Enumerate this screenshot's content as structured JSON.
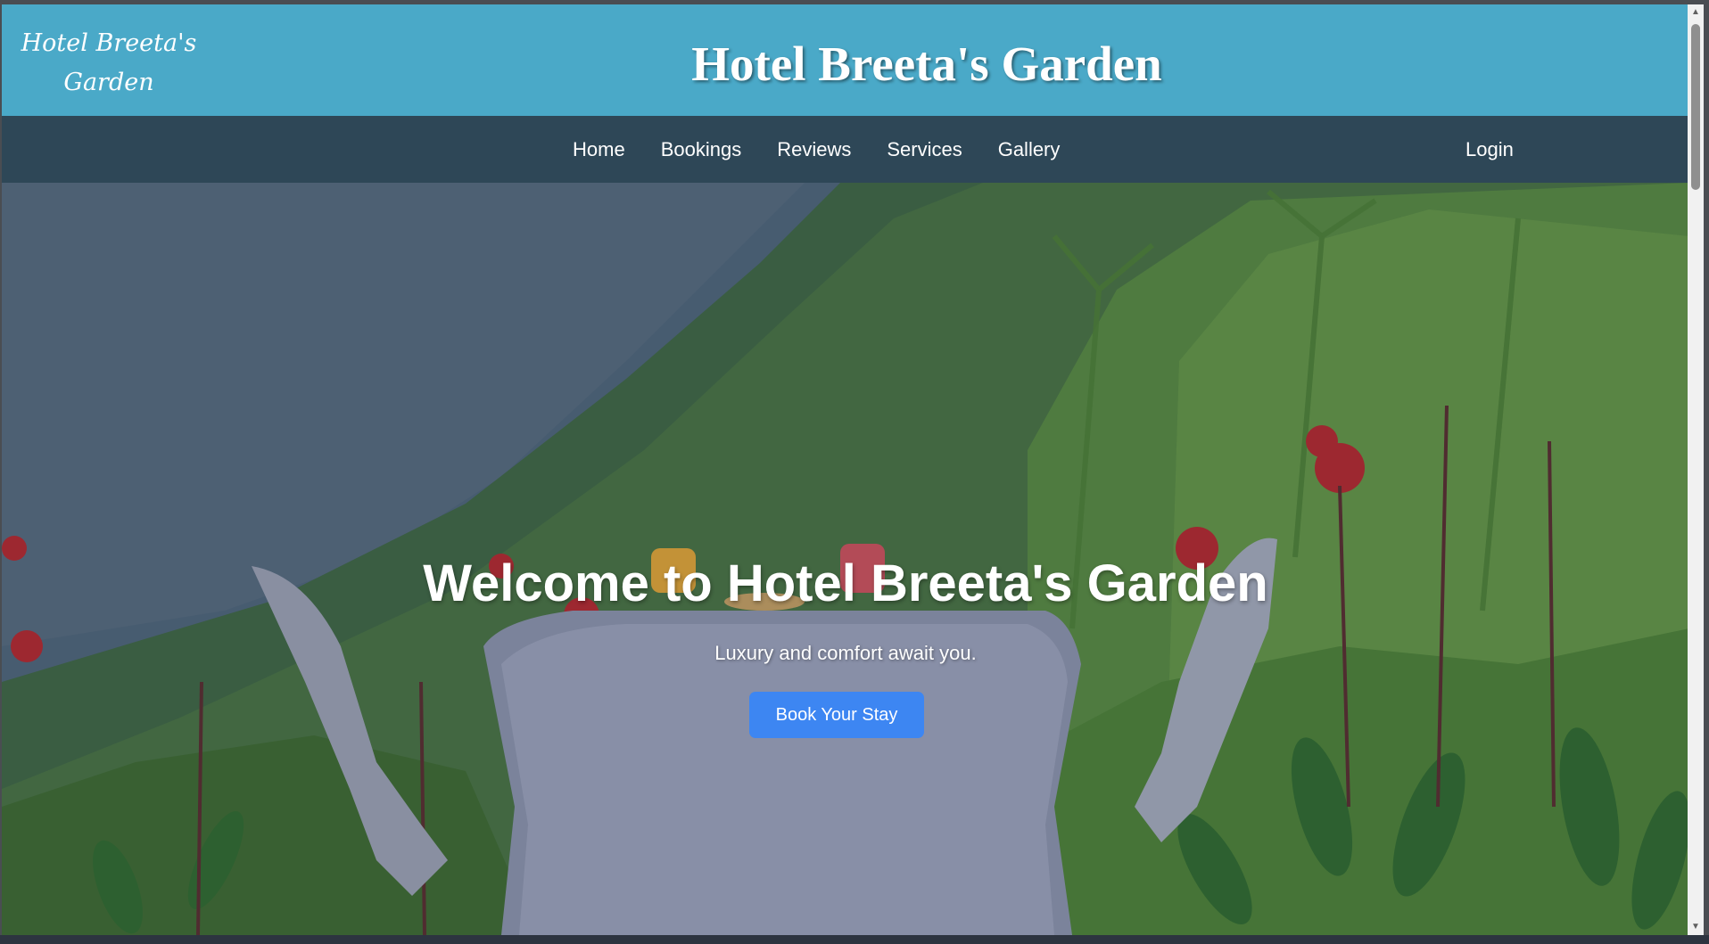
{
  "header": {
    "logo_line1": "Hotel Breeta's",
    "logo_line2": "Garden",
    "title": "Hotel Breeta's Garden"
  },
  "nav": {
    "items": [
      {
        "label": "Home"
      },
      {
        "label": "Bookings"
      },
      {
        "label": "Reviews"
      },
      {
        "label": "Services"
      },
      {
        "label": "Gallery"
      }
    ],
    "login": "Login"
  },
  "hero": {
    "title": "Welcome to Hotel Breeta's Garden",
    "subtitle": "Luxury and comfort await you.",
    "cta": "Book Your Stay"
  },
  "colors": {
    "header_bg": "#4aa9c8",
    "nav_bg": "#2e4757",
    "button_bg": "#3d86f2"
  },
  "icons": {
    "scroll_up": "triangle-up-icon",
    "scroll_down": "triangle-down-icon"
  }
}
